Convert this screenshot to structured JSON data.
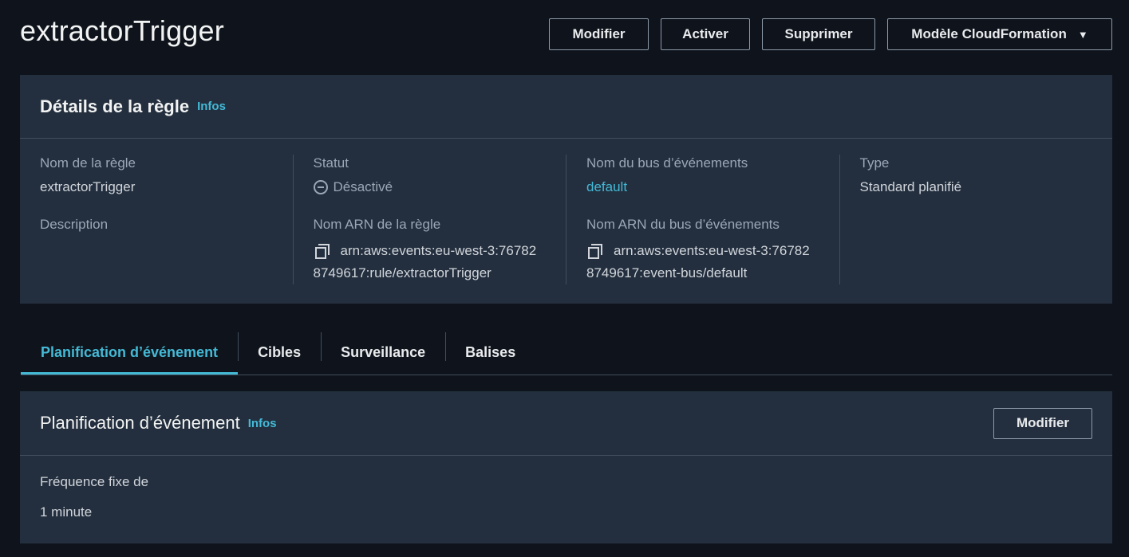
{
  "header": {
    "title": "extractorTrigger",
    "buttons": {
      "modify": "Modifier",
      "enable": "Activer",
      "delete": "Supprimer",
      "cloudformation": "Modèle CloudFormation"
    }
  },
  "details": {
    "title": "Détails de la règle",
    "info": "Infos",
    "rule_name_label": "Nom de la règle",
    "rule_name": "extractorTrigger",
    "description_label": "Description",
    "status_label": "Statut",
    "status": "Désactivé",
    "rule_arn_label": "Nom ARN de la règle",
    "rule_arn_line1": "arn:aws:events:eu-west-3:76782",
    "rule_arn_line2": "8749617:rule/extractorTrigger",
    "bus_name_label": "Nom du bus d’événements",
    "bus_name": "default",
    "bus_arn_label": "Nom ARN du bus d’événements",
    "bus_arn_line1": "arn:aws:events:eu-west-3:76782",
    "bus_arn_line2": "8749617:event-bus/default",
    "type_label": "Type",
    "type": "Standard planifié"
  },
  "tabs": [
    {
      "label": "Planification d’événement"
    },
    {
      "label": "Cibles"
    },
    {
      "label": "Surveillance"
    },
    {
      "label": "Balises"
    }
  ],
  "schedule": {
    "title": "Planification d’événement",
    "info": "Infos",
    "modify": "Modifier",
    "frequency_label": "Fréquence fixe de",
    "frequency_value": "1 minute"
  }
}
